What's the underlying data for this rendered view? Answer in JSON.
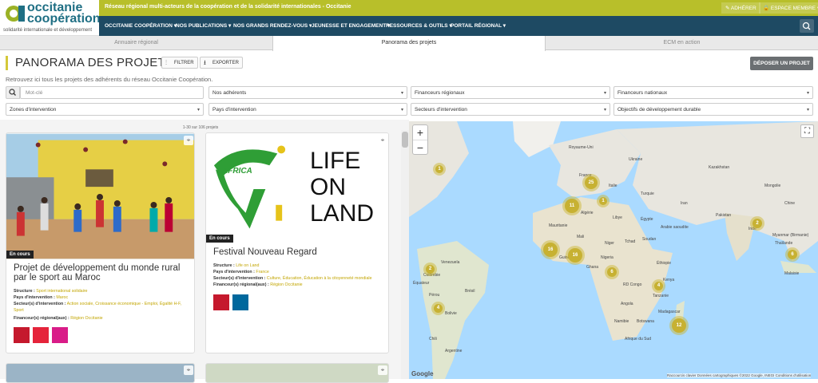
{
  "brand": {
    "line1": "occitanie",
    "line2": "coopération",
    "subtitle": "solidarité internationale et développement"
  },
  "topbar": {
    "tagline": "Réseau régional multi-acteurs de la coopération et de la solidarité internationales - Occitanie",
    "adherer": "ADHÉRER",
    "espace": "ESPACE MEMBRE"
  },
  "nav": [
    "OCCITANIE COOPÉRATION",
    "NOS PUBLICATIONS",
    "NOS GRANDS RENDEZ-VOUS",
    "JEUNESSE ET ENGAGEMENT",
    "RESSOURCES & OUTILS",
    "PORTAIL RÉGIONAL"
  ],
  "tabs": [
    "Annuaire régional",
    "Panorama des projets",
    "ECM en action"
  ],
  "header": {
    "title": "PANORAMA DES PROJETS",
    "filter_btn": "FILTRER",
    "export_btn": "EXPORTER",
    "deposit_btn": "DÉPOSER UN PROJET",
    "intro": "Retrouvez ici tous les projets des adhérents du réseau Occitanie Coopération."
  },
  "filters": {
    "keyword_placeholder": "Mot-clé",
    "adherents": "Nos adhérents",
    "fin_regionaux": "Financeurs régionaux",
    "fin_nationaux": "Financeurs nationaux",
    "zones": "Zones d'intervention",
    "pays": "Pays d'intervention",
    "secteurs": "Secteurs d'intervention",
    "odd": "Objectifs de développement durable"
  },
  "list": {
    "count": "1-30 sur 106 projets",
    "cards": [
      {
        "status": "En cours",
        "title": "Projet de développement du monde rural par le sport au Maroc",
        "structure_label": "Structure :",
        "structure": "Sport international solidaire",
        "pays_label": "Pays d'intervention :",
        "pays": "Maroc",
        "secteurs_label": "Secteur(s) d'intervention :",
        "secteurs": "Action sociale, Croissance économique - Emploi, Égalité H-F, Sport",
        "fin_label": "Financeur(s) régional(aux) :",
        "fin": "Région Occitanie",
        "odd": [
          {
            "n": "4",
            "color": "#c5192d"
          },
          {
            "n": "8",
            "color": "#e5243b"
          },
          {
            "n": "5",
            "color": "#ff3a21"
          }
        ]
      },
      {
        "status": "En cours",
        "title": "Festival Nouveau Regard",
        "logo_line1": "LIFE",
        "logo_line2": "ON",
        "logo_line3": "LAND",
        "logo_africa": "AFRICA",
        "structure_label": "Structure :",
        "structure": "Life on Land",
        "pays_label": "Pays d'intervention :",
        "pays": "France",
        "secteurs_label": "Secteur(s) d'intervention :",
        "secteurs": "Culture, Éducation, Éducation à la citoyenneté mondiale",
        "fin_label": "Financeur(s) régional(aux) :",
        "fin": "Région Occitanie",
        "odd": [
          {
            "n": "4",
            "color": "#c5192d"
          },
          {
            "n": "16",
            "color": "#00689d"
          }
        ]
      }
    ]
  },
  "map": {
    "clusters": [
      {
        "n": "1"
      },
      {
        "n": "25"
      },
      {
        "n": "1"
      },
      {
        "n": "11"
      },
      {
        "n": "16"
      },
      {
        "n": "16"
      },
      {
        "n": "2"
      },
      {
        "n": "6"
      },
      {
        "n": "4"
      },
      {
        "n": "4"
      },
      {
        "n": "12"
      },
      {
        "n": "2"
      },
      {
        "n": "6"
      }
    ],
    "labels": [
      "Royaume-Uni",
      "Ukraine",
      "Kazakhstan",
      "France",
      "Italie",
      "Turquie",
      "Iran",
      "Pakistan",
      "Algérie",
      "Libye",
      "Égypte",
      "Arabie saoudite",
      "Inde",
      "Mali",
      "Niger",
      "Tchad",
      "Soudan",
      "Nigeria",
      "Éthiopie",
      "Kenya",
      "Tanzanie",
      "RD Congo",
      "Angola",
      "Namibie",
      "Botswana",
      "Afrique du Sud",
      "Madagascar",
      "Brésil",
      "Pérou",
      "Bolivie",
      "Colombie",
      "Venezuela",
      "Chili",
      "Argentine",
      "Thaïlande",
      "Malaisie",
      "Mongolie",
      "Chine",
      "Myanmar (Birmanie)",
      "Mauritanie",
      "Guinée",
      "Ghana",
      "Équateur"
    ],
    "footer": "Raccourcis clavier   Données cartographiques ©2022 Google, INEGI   Conditions d'utilisation",
    "google": "Google"
  },
  "colors": {
    "accent": "#b8bf2a",
    "nav": "#1e4a63",
    "cluster": "#c7b132",
    "deposit": "#6b6f72"
  }
}
